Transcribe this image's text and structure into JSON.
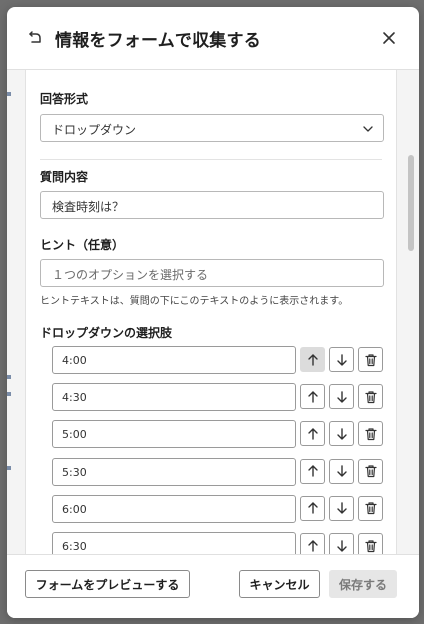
{
  "dialog": {
    "title": "情報をフォームで収集する"
  },
  "form": {
    "answer_format_label": "回答形式",
    "answer_format_value": "ドロップダウン",
    "question_label": "質問内容",
    "question_value": "検査時刻は？",
    "hint_label": "ヒント（任意）",
    "hint_placeholder": "１つのオプションを選択する",
    "hint_help": "ヒントテキストは、質問の下にこのテキストのように表示されます。",
    "options_label": "ドロップダウンの選択肢",
    "options": [
      "4:00",
      "4:30",
      "5:00",
      "5:30",
      "6:00",
      "6:30"
    ]
  },
  "footer": {
    "preview_label": "フォームをプレビューする",
    "cancel_label": "キャンセル",
    "save_label": "保存する"
  }
}
